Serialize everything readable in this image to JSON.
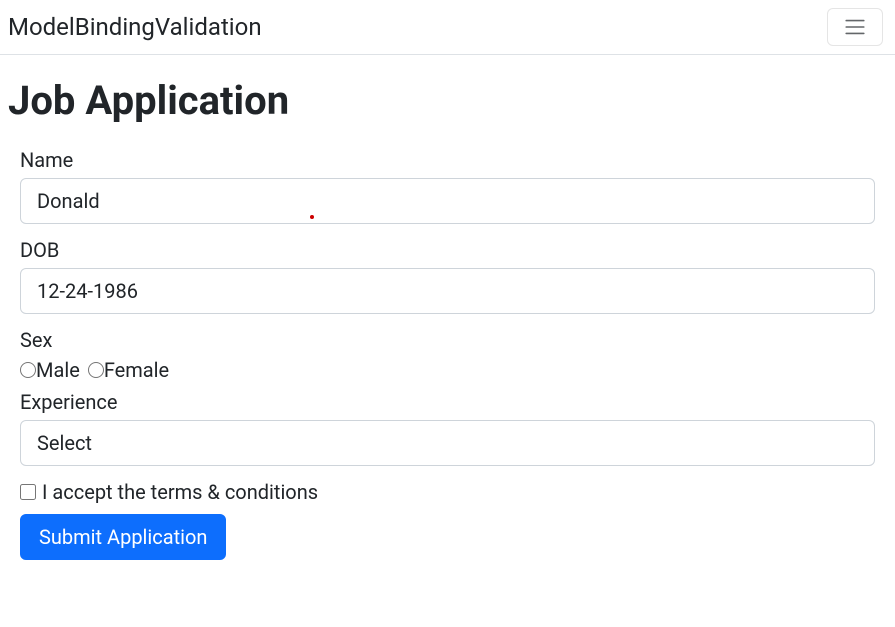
{
  "navbar": {
    "brand": "ModelBindingValidation"
  },
  "page": {
    "title": "Job Application"
  },
  "form": {
    "name": {
      "label": "Name",
      "value": "Donald"
    },
    "dob": {
      "label": "DOB",
      "value": "12-24-1986"
    },
    "sex": {
      "label": "Sex",
      "male": "Male",
      "female": "Female"
    },
    "experience": {
      "label": "Experience",
      "selected": "Select"
    },
    "terms": {
      "label": "I accept the terms & conditions"
    },
    "submit": {
      "label": "Submit Application"
    }
  }
}
